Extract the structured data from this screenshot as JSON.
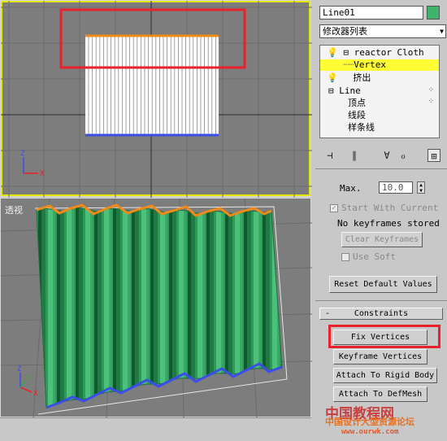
{
  "viewports": {
    "top": {
      "label": ""
    },
    "perspective": {
      "label": "透视"
    }
  },
  "axes": {
    "z": "Z",
    "x": "X",
    "y": "Y"
  },
  "panel": {
    "object_name": "Line01",
    "object_color": "#3fb36a",
    "modifier_list": "修改器列表",
    "modifier_list_arrow": "▼",
    "stack": [
      {
        "icon": "bulb-icon",
        "expander": "⊟",
        "label": "reactor Cloth"
      },
      {
        "icon": "",
        "expander": "",
        "label": "Vertex",
        "selected": true
      },
      {
        "icon": "bulb-icon",
        "expander": "",
        "label": "挤出"
      },
      {
        "icon": "",
        "expander": "⊟",
        "label": "Line"
      },
      {
        "icon": "",
        "expander": "",
        "label": "顶点"
      },
      {
        "icon": "",
        "expander": "",
        "label": "线段"
      },
      {
        "icon": "",
        "expander": "",
        "label": "样条线"
      }
    ],
    "max_label": "Max.",
    "max_value": "10.0",
    "start_with_current": "Start With Current",
    "no_keyframes": "No keyframes stored",
    "clear_keyframes": "Clear Keyframes",
    "use_soft": "Use Soft",
    "reset_default": "Reset Default Values",
    "constraints_toggle": "-",
    "constraints_title": "Constraints",
    "fix_vertices": "Fix Vertices",
    "keyframe_vertices": "Keyframe Vertices",
    "attach_rigid_body": "Attach To Rigid Body",
    "attach_defmesh": "Attach To DefMesh"
  },
  "watermark": {
    "site": "中国教程网",
    "subtitle": "中国设计大型资源论坛",
    "url": "www.ourwk.com"
  },
  "colors": {
    "highlight_red": "#e8212b",
    "selected_row": "#ffff33",
    "cloth_green": "#2e9a5a",
    "fixed_vertex_orange": "#f08a18",
    "bottom_vertex_blue": "#3b4fe8"
  }
}
